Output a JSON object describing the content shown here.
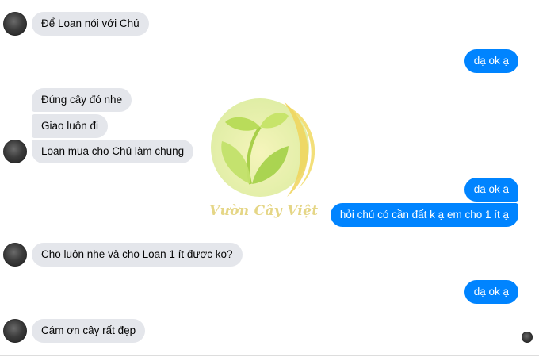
{
  "messages": [
    {
      "text": "Để Loan nói với Chú"
    },
    {
      "text": "dạ ok ạ"
    },
    {
      "text": "Đúng cây đó nhe"
    },
    {
      "text": "Giao luôn đi"
    },
    {
      "text": "Loan mua cho Chú làm chung"
    },
    {
      "text": "dạ ok ạ"
    },
    {
      "text": "hỏi chú có cần đất k ạ em cho 1 ít ạ"
    },
    {
      "text": "Cho luôn nhe và cho Loan 1 ít được ko?"
    },
    {
      "text": "dạ ok ạ"
    },
    {
      "text": "Cám ơn cây rất đẹp"
    }
  ],
  "watermark": {
    "brand": "Vườn Cây Việt"
  },
  "colors": {
    "incoming": "#e4e6eb",
    "outgoing": "#0084ff",
    "watermark": "#e3d27a"
  }
}
